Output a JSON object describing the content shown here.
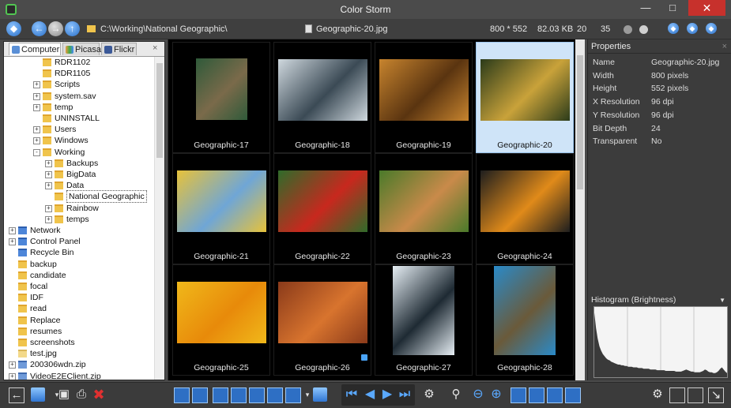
{
  "window": {
    "title": "Color Storm"
  },
  "nav": {
    "path": "C:\\Working\\National Geographic\\",
    "filename": "Geographic-20.jpg",
    "dimensions": "800 * 552",
    "filesize": "82.03 KB",
    "count_a": "20",
    "count_b": "35"
  },
  "left_tabs": [
    "Computer",
    "Picasa",
    "Flickr"
  ],
  "tree": [
    {
      "label": "RDR1102",
      "indent": 3,
      "expander": "",
      "icon": "folder"
    },
    {
      "label": "RDR1105",
      "indent": 3,
      "expander": "",
      "icon": "folder"
    },
    {
      "label": "Scripts",
      "indent": 3,
      "expander": "+",
      "icon": "folder"
    },
    {
      "label": "system.sav",
      "indent": 3,
      "expander": "+",
      "icon": "folder"
    },
    {
      "label": "temp",
      "indent": 3,
      "expander": "+",
      "icon": "folder"
    },
    {
      "label": "UNINSTALL",
      "indent": 3,
      "expander": "",
      "icon": "folder"
    },
    {
      "label": "Users",
      "indent": 3,
      "expander": "+",
      "icon": "folder"
    },
    {
      "label": "Windows",
      "indent": 3,
      "expander": "+",
      "icon": "folder"
    },
    {
      "label": "Working",
      "indent": 3,
      "expander": "-",
      "icon": "folder"
    },
    {
      "label": "Backups",
      "indent": 4,
      "expander": "+",
      "icon": "folder"
    },
    {
      "label": "BigData",
      "indent": 4,
      "expander": "+",
      "icon": "folder"
    },
    {
      "label": "Data",
      "indent": 4,
      "expander": "+",
      "icon": "folder"
    },
    {
      "label": "National Geographic",
      "indent": 4,
      "expander": "",
      "icon": "folder",
      "selected": true
    },
    {
      "label": "Rainbow",
      "indent": 4,
      "expander": "+",
      "icon": "folder"
    },
    {
      "label": "temps",
      "indent": 4,
      "expander": "+",
      "icon": "folder"
    },
    {
      "label": "Network",
      "indent": 1,
      "expander": "+",
      "icon": "blue"
    },
    {
      "label": "Control Panel",
      "indent": 1,
      "expander": "+",
      "icon": "blue"
    },
    {
      "label": "Recycle Bin",
      "indent": 1,
      "expander": "",
      "icon": "blue"
    },
    {
      "label": "backup",
      "indent": 1,
      "expander": "",
      "icon": "folder"
    },
    {
      "label": "candidate",
      "indent": 1,
      "expander": "",
      "icon": "folder"
    },
    {
      "label": "focal",
      "indent": 1,
      "expander": "",
      "icon": "folder"
    },
    {
      "label": "IDF",
      "indent": 1,
      "expander": "",
      "icon": "folder"
    },
    {
      "label": "read",
      "indent": 1,
      "expander": "",
      "icon": "folder"
    },
    {
      "label": "Replace",
      "indent": 1,
      "expander": "",
      "icon": "folder"
    },
    {
      "label": "resumes",
      "indent": 1,
      "expander": "",
      "icon": "folder"
    },
    {
      "label": "screenshots",
      "indent": 1,
      "expander": "",
      "icon": "folder"
    },
    {
      "label": "test.jpg",
      "indent": 1,
      "expander": "",
      "icon": "file"
    },
    {
      "label": "200306wdn.zip",
      "indent": 1,
      "expander": "+",
      "icon": "zip"
    },
    {
      "label": "VideoE2EClient.zip",
      "indent": 1,
      "expander": "+",
      "icon": "zip"
    }
  ],
  "thumbnails": [
    {
      "caption": "Geographic-17",
      "subject": "mandrill",
      "colors": [
        "#2f5a3a",
        "#7a6a4a"
      ],
      "orient": "square"
    },
    {
      "caption": "Geographic-18",
      "subject": "penguins",
      "colors": [
        "#cfd8de",
        "#3b4a55"
      ],
      "orient": "wide"
    },
    {
      "caption": "Geographic-19",
      "subject": "lion",
      "colors": [
        "#c7842e",
        "#5a3410"
      ],
      "orient": "wide"
    },
    {
      "caption": "Geographic-20",
      "subject": "cobra",
      "colors": [
        "#2b3b1a",
        "#c9a23a"
      ],
      "orient": "wide",
      "selected": true
    },
    {
      "caption": "Geographic-21",
      "subject": "umbrellas",
      "colors": [
        "#e7c23a",
        "#6fa6d6"
      ],
      "orient": "wide"
    },
    {
      "caption": "Geographic-22",
      "subject": "parrot",
      "colors": [
        "#2f6b2a",
        "#c8281e"
      ],
      "orient": "wide"
    },
    {
      "caption": "Geographic-23",
      "subject": "beagle",
      "colors": [
        "#4a7a2a",
        "#c98a4a"
      ],
      "orient": "wide"
    },
    {
      "caption": "Geographic-24",
      "subject": "toucan",
      "colors": [
        "#1e1e1e",
        "#e08a1a"
      ],
      "orient": "wide"
    },
    {
      "caption": "Geographic-25",
      "subject": "flower",
      "colors": [
        "#f0b81a",
        "#e88a0a"
      ],
      "orient": "wide"
    },
    {
      "caption": "Geographic-26",
      "subject": "girl",
      "colors": [
        "#8a3a1a",
        "#d8742e"
      ],
      "orient": "wide",
      "tagged": true
    },
    {
      "caption": "Geographic-27",
      "subject": "penguin family",
      "colors": [
        "#e6eef4",
        "#1e2a33"
      ],
      "orient": "tall"
    },
    {
      "caption": "Geographic-28",
      "subject": "turtle",
      "colors": [
        "#2a8ac8",
        "#6a5a3a"
      ],
      "orient": "tall"
    }
  ],
  "properties": {
    "title": "Properties",
    "rows": [
      {
        "key": "Name",
        "value": "Geographic-20.jpg"
      },
      {
        "key": "Width",
        "value": "800 pixels"
      },
      {
        "key": "Height",
        "value": "552 pixels"
      },
      {
        "key": "X Resolution",
        "value": "96 dpi"
      },
      {
        "key": "Y Resolution",
        "value": "96 dpi"
      },
      {
        "key": "Bit Depth",
        "value": "24"
      },
      {
        "key": "Transparent",
        "value": "No"
      }
    ]
  },
  "histogram": {
    "title": "Histogram (Brightness)",
    "levels": [
      92,
      70,
      55,
      44,
      38,
      33,
      30,
      27,
      25,
      24,
      22,
      21,
      20,
      19,
      18,
      18,
      17,
      17,
      16,
      16,
      15,
      15,
      15,
      14,
      14,
      14,
      13,
      13,
      13,
      12,
      12,
      12,
      12,
      11,
      11,
      11,
      11,
      10,
      10,
      10,
      10,
      10,
      9,
      9,
      9,
      9,
      9,
      9,
      8,
      8,
      8,
      8,
      9,
      10,
      11,
      10,
      9,
      8,
      8,
      7,
      7,
      7,
      7,
      8,
      9,
      11,
      10,
      8,
      7,
      7,
      6,
      6,
      7,
      9,
      12,
      14,
      11,
      8,
      6
    ]
  },
  "colors": {
    "accent": "#4aa3f5",
    "selection": "#cfe4f8",
    "close": "#c7312c"
  }
}
